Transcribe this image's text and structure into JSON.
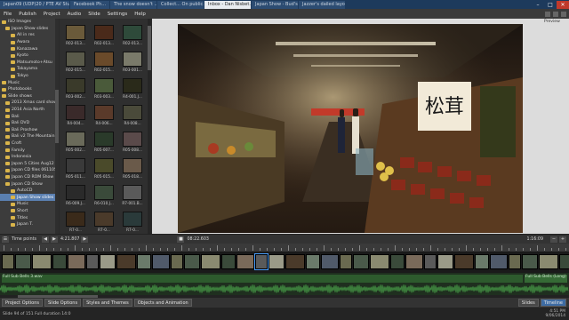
{
  "colors": {
    "accent": "#3d6ba3",
    "folder": "#d9b44a",
    "titlebar": "#1d3a5c"
  },
  "browser_tabs": [
    {
      "label": "Japan09 (UDP)20 / PTE AV Studio Pro",
      "active": false
    },
    {
      "label": "Facebook Ph...",
      "active": false
    },
    {
      "label": "The snow doesn't ...",
      "active": false
    },
    {
      "label": "Collect... On public...",
      "active": false
    },
    {
      "label": "Inbox - Dan Nisbet...",
      "active": true
    },
    {
      "label": "Japan Show - Bud's Ph...",
      "active": false
    },
    {
      "label": "Jazzer's dailed layout",
      "active": false
    }
  ],
  "menu": [
    "File",
    "Publish",
    "Project",
    "Audio",
    "Slide",
    "Settings",
    "Help"
  ],
  "tree": [
    {
      "label": "ISO Images",
      "selected": false
    },
    {
      "label": "Japan Show slides",
      "selected": false
    },
    {
      "label": "All in res",
      "selected": false
    },
    {
      "label": "Awara",
      "selected": false
    },
    {
      "label": "Kanazawa",
      "selected": false
    },
    {
      "label": "Kyoto",
      "selected": false
    },
    {
      "label": "Matsumoto+Atsu",
      "selected": false
    },
    {
      "label": "Takayama",
      "selected": false
    },
    {
      "label": "Tokyo",
      "selected": false
    },
    {
      "label": "Music",
      "selected": false
    },
    {
      "label": "Photobooks",
      "selected": false
    },
    {
      "label": "Slide shows",
      "selected": false
    },
    {
      "label": "2013 Xmas card show",
      "selected": false
    },
    {
      "label": "2014 Asia North",
      "selected": false
    },
    {
      "label": "Bali",
      "selected": false
    },
    {
      "label": "Bali DVD",
      "selected": false
    },
    {
      "label": "Bali Proshow",
      "selected": false
    },
    {
      "label": "Bali v2 The Mountain pt",
      "selected": false
    },
    {
      "label": "Croft",
      "selected": false
    },
    {
      "label": "Family",
      "selected": false
    },
    {
      "label": "Indonesia",
      "selected": false
    },
    {
      "label": "Japan 5 Cities Aug12",
      "selected": false
    },
    {
      "label": "Japan CD files 061105",
      "selected": false
    },
    {
      "label": "Japan CD ROM Show",
      "selected": false
    },
    {
      "label": "Japan CD Show",
      "selected": false
    },
    {
      "label": "AutoCD",
      "selected": false
    },
    {
      "label": "Japan Show slides",
      "selected": true
    },
    {
      "label": "Music",
      "selected": false
    },
    {
      "label": "Short",
      "selected": false
    },
    {
      "label": "Titles",
      "selected": false
    },
    {
      "label": "Japan T.",
      "selected": false
    }
  ],
  "thumbs": [
    {
      "caption": "R02-013...",
      "color": "#6a5a3a"
    },
    {
      "caption": "R02-013...",
      "color": "#4a2a1a"
    },
    {
      "caption": "R02-013...",
      "color": "#2e4a3a"
    },
    {
      "caption": "R02-015...",
      "color": "#5a5a4a"
    },
    {
      "caption": "R02-015...",
      "color": "#6a4a2a"
    },
    {
      "caption": "R03-001...",
      "color": "#7a7a6a"
    },
    {
      "caption": "R03-002...",
      "color": "#3a3a2a"
    },
    {
      "caption": "R03-003...",
      "color": "#4a5a3a"
    },
    {
      "caption": "R4-001.J...",
      "color": "#2a2a1a"
    },
    {
      "caption": "R4-004...",
      "color": "#3a2a2a"
    },
    {
      "caption": "R4-006...",
      "color": "#5a3a2a"
    },
    {
      "caption": "R4-008...",
      "color": "#4a4a3a"
    },
    {
      "caption": "R05-002...",
      "color": "#6a6a5a"
    },
    {
      "caption": "R05-007...",
      "color": "#2a3a2a"
    },
    {
      "caption": "R05-008...",
      "color": "#5a4a4a"
    },
    {
      "caption": "R05-011...",
      "color": "#3a3a3a"
    },
    {
      "caption": "R05-015...",
      "color": "#4a4a2a"
    },
    {
      "caption": "R05-018...",
      "color": "#6a5a4a"
    },
    {
      "caption": "R6-009.J...",
      "color": "#2a2a2a"
    },
    {
      "caption": "R6-010.J...",
      "color": "#3a4a3a"
    },
    {
      "caption": "R7-001.B...",
      "color": "#5a5a5a"
    },
    {
      "caption": "R7-0...",
      "color": "#3a2a1a"
    },
    {
      "caption": "R7-0...",
      "color": "#4a3a2a"
    },
    {
      "caption": "R7-0...",
      "color": "#2a3a3a"
    }
  ],
  "preview_label": "Preview",
  "photo_sign": "松茸",
  "transport": {
    "mode_label": "Time points",
    "time_current": "4:21.807",
    "time_mid": "08:22.603",
    "time_total": "1:16:09"
  },
  "timeline": {
    "track1_label": "Full Sub Bells 3.wav",
    "track2_label": "Full Sub Bells (Long)"
  },
  "bottom_buttons": [
    "Project Options",
    "Slide Options",
    "Styles and Themes",
    "Objects and Animation"
  ],
  "bottom_right_buttons": [
    "Slides",
    "Timeline"
  ],
  "status": {
    "text": "Slide 94 of 151 Full duration 14:0",
    "tray_time": "4:51 PM",
    "tray_date": "9/06/2014"
  }
}
